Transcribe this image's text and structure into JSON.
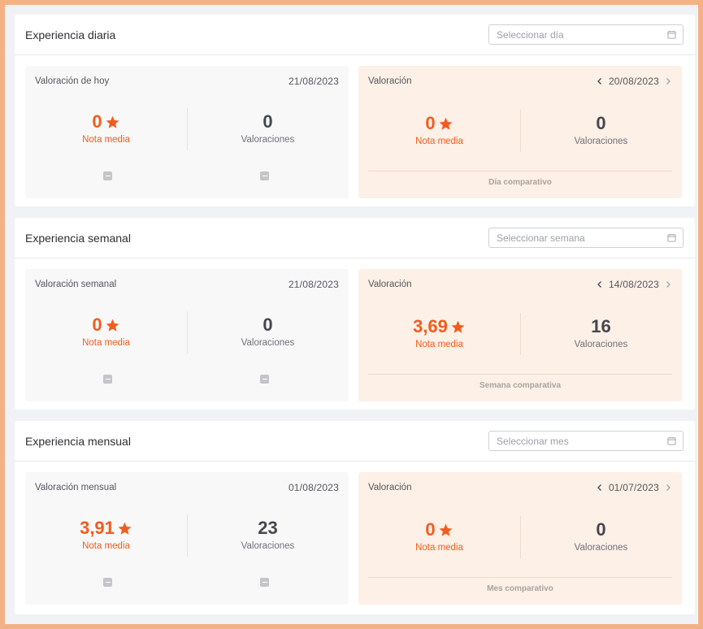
{
  "sections": [
    {
      "title": "Experiencia diaria",
      "placeholder": "Seleccionar día",
      "current": {
        "label": "Valoración de hoy",
        "date": "21/08/2023",
        "score": "0",
        "score_label": "Nota media",
        "count": "0",
        "count_label": "Valoraciones"
      },
      "comparison": {
        "label": "Valoración",
        "date": "20/08/2023",
        "score": "0",
        "score_label": "Nota media",
        "count": "0",
        "count_label": "Valoraciones",
        "footer": "Día comparativo"
      }
    },
    {
      "title": "Experiencia semanal",
      "placeholder": "Seleccionar semana",
      "current": {
        "label": "Valoración semanal",
        "date": "21/08/2023",
        "score": "0",
        "score_label": "Nota media",
        "count": "0",
        "count_label": "Valoraciones"
      },
      "comparison": {
        "label": "Valoración",
        "date": "14/08/2023",
        "score": "3,69",
        "score_label": "Nota media",
        "count": "16",
        "count_label": "Valoraciones",
        "footer": "Semana comparativa"
      }
    },
    {
      "title": "Experiencia mensual",
      "placeholder": "Seleccionar mes",
      "current": {
        "label": "Valoración mensual",
        "date": "01/08/2023",
        "score": "3,91",
        "score_label": "Nota media",
        "count": "23",
        "count_label": "Valoraciones"
      },
      "comparison": {
        "label": "Valoración",
        "date": "01/07/2023",
        "score": "0",
        "score_label": "Nota media",
        "count": "0",
        "count_label": "Valoraciones",
        "footer": "Mes comparativo"
      }
    }
  ],
  "colors": {
    "accent": "#f25c1e",
    "comparison_bg": "#fdf0e6",
    "frame": "#f2b286"
  },
  "icons": {
    "date_selector": "calendar-icon",
    "rating": "star-icon",
    "prev": "chevron-left-icon",
    "next": "chevron-right-icon",
    "empty_trend": "minus-icon"
  }
}
